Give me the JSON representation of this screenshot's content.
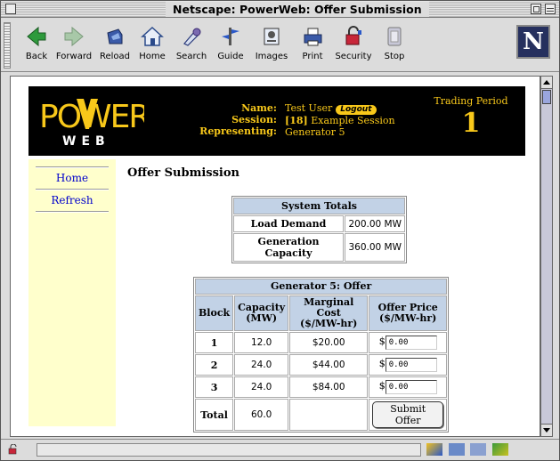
{
  "window": {
    "title": "Netscape: PowerWeb: Offer Submission"
  },
  "toolbar": {
    "buttons": [
      {
        "label": "Back",
        "icon": "back-arrow-icon"
      },
      {
        "label": "Forward",
        "icon": "forward-arrow-icon"
      },
      {
        "label": "Reload",
        "icon": "reload-icon"
      },
      {
        "label": "Home",
        "icon": "home-icon"
      },
      {
        "label": "Search",
        "icon": "search-icon"
      },
      {
        "label": "Guide",
        "icon": "guide-icon"
      },
      {
        "label": "Images",
        "icon": "images-icon"
      },
      {
        "label": "Print",
        "icon": "print-icon"
      },
      {
        "label": "Security",
        "icon": "security-lock-icon"
      },
      {
        "label": "Stop",
        "icon": "stop-icon"
      }
    ],
    "brand": "N"
  },
  "header": {
    "logo_top": "POWER",
    "logo_bottom": "WEB",
    "name_label": "Name:",
    "session_label": "Session:",
    "representing_label": "Representing:",
    "name_value": "Test User",
    "logout_label": "Logout",
    "session_id": "[18]",
    "session_name": "Example Session",
    "representing_value": "Generator 5",
    "period_label": "Trading Period",
    "period_value": "1"
  },
  "sidebar": {
    "items": [
      {
        "label": "Home"
      },
      {
        "label": "Refresh"
      }
    ]
  },
  "main": {
    "title": "Offer Submission",
    "totals": {
      "header": "System Totals",
      "rows": [
        {
          "label": "Load Demand",
          "value": "200.00 MW"
        },
        {
          "label": "Generation Capacity",
          "value": "360.00 MW"
        }
      ]
    },
    "offer": {
      "header": "Generator 5: Offer",
      "columns": {
        "block": "Block",
        "capacity": "Capacity",
        "capacity_unit": "(MW)",
        "marginal_cost": "Marginal Cost",
        "marginal_cost_unit": "($/MW-hr)",
        "offer_price": "Offer Price",
        "offer_price_unit": "($/MW-hr)"
      },
      "rows": [
        {
          "block": "1",
          "capacity": "12.0",
          "marginal_cost": "$20.00",
          "currency": "$",
          "price": "0.00"
        },
        {
          "block": "2",
          "capacity": "24.0",
          "marginal_cost": "$44.00",
          "currency": "$",
          "price": "0.00"
        },
        {
          "block": "3",
          "capacity": "24.0",
          "marginal_cost": "$84.00",
          "currency": "$",
          "price": "0.00"
        }
      ],
      "total_label": "Total",
      "total_capacity": "60.0",
      "submit_label": "Submit Offer"
    }
  },
  "colors": {
    "banner_bg": "#000000",
    "banner_text": "#f8c81a",
    "sidebar_bg": "#ffffcc",
    "table_header_bg": "#c2d2e6",
    "link": "#0000cc"
  }
}
